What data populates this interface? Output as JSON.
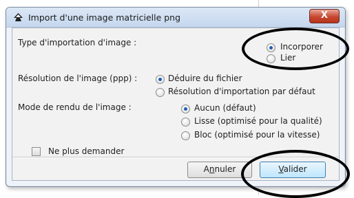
{
  "window": {
    "title": "Import d'une image matricielle png",
    "close_glyph": "X",
    "app_icon": "inkscape-icon"
  },
  "image_import": {
    "label": "Type d'importation d'image :",
    "options": [
      "Incorporer",
      "Lier"
    ],
    "selected": "Incorporer"
  },
  "resolution": {
    "label": "Résolution de l'image (ppp) :",
    "options": [
      "Déduire du fichier",
      "Résolution d'importation par défaut"
    ],
    "selected": "Déduire du fichier"
  },
  "render_mode": {
    "label": "Mode de rendu de l'image :",
    "options": [
      "Aucun (défaut)",
      "Lisse (optimisé pour la qualité)",
      "Bloc (optimisé pour la vitesse)"
    ],
    "selected": "Aucun (défaut)"
  },
  "dont_ask": {
    "label": "Ne plus demander",
    "checked": false
  },
  "buttons": {
    "cancel_pre": "A",
    "cancel_mnemonic": "n",
    "cancel_post": "nuler",
    "ok_mnemonic": "V",
    "ok_post": "alider"
  },
  "colors": {
    "title_bar": "#c5d7ee",
    "close_button": "#c7472f",
    "radio_dot": "#1f5fb4",
    "annotation": "#000000"
  }
}
